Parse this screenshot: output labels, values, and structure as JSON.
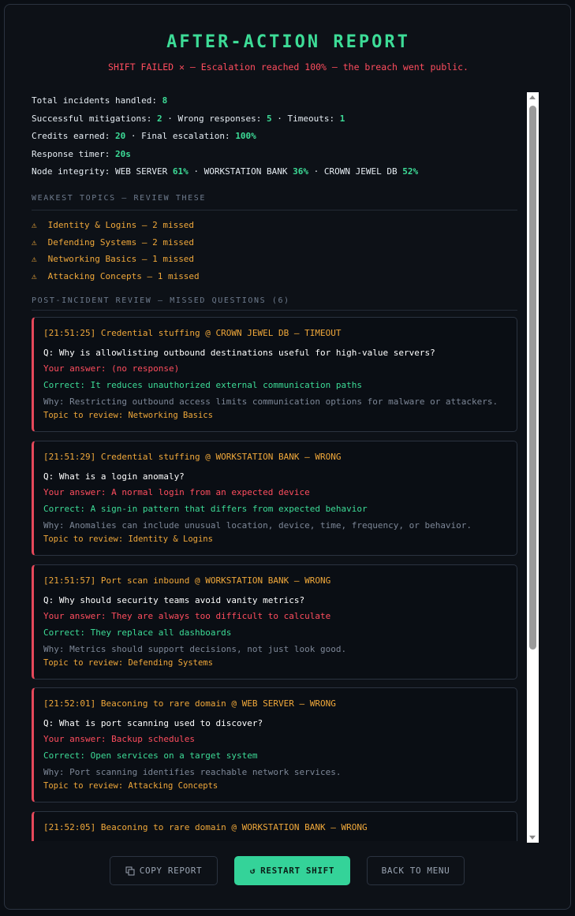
{
  "header": {
    "title": "AFTER-ACTION REPORT",
    "subtitle": "SHIFT FAILED ✕ — Escalation reached 100% — the breach went public."
  },
  "stats": {
    "total_label": "Total incidents handled:",
    "total_value": "8",
    "success_label": "Successful mitigations:",
    "success_value": "2",
    "wrong_label": "Wrong responses:",
    "wrong_value": "5",
    "timeouts_label": "Timeouts:",
    "timeouts_value": "1",
    "credits_label": "Credits earned:",
    "credits_value": "20",
    "escalation_label": "Final escalation:",
    "escalation_value": "100%",
    "timer_label": "Response timer:",
    "timer_value": "20s",
    "integrity_label": "Node integrity:",
    "nodes": [
      {
        "name": "WEB SERVER",
        "value": "61%"
      },
      {
        "name": "WORKSTATION BANK",
        "value": "36%"
      },
      {
        "name": "CROWN JEWEL DB",
        "value": "52%"
      }
    ],
    "separator": "·"
  },
  "weakest": {
    "heading": "WEAKEST TOPICS — REVIEW THESE",
    "icon": "warning-icon",
    "items": [
      "Identity & Logins — 2 missed",
      "Defending Systems — 2 missed",
      "Networking Basics — 1 missed",
      "Attacking Concepts — 1 missed"
    ]
  },
  "review": {
    "heading": "POST-INCIDENT REVIEW — MISSED QUESTIONS (6)",
    "cards": [
      {
        "head": "[21:51:25] Credential stuffing @ CROWN JEWEL DB — TIMEOUT",
        "question": "Q: Why is allowlisting outbound destinations useful for high-value servers?",
        "your_answer": "Your answer: (no response)",
        "correct": "Correct: It reduces unauthorized external communication paths",
        "why": "Why: Restricting outbound access limits communication options for malware or attackers.",
        "topic": "Topic to review: Networking Basics"
      },
      {
        "head": "[21:51:29] Credential stuffing @ WORKSTATION BANK — WRONG",
        "question": "Q: What is a login anomaly?",
        "your_answer": "Your answer: A normal login from an expected device",
        "correct": "Correct: A sign-in pattern that differs from expected behavior",
        "why": "Why: Anomalies can include unusual location, device, time, frequency, or behavior.",
        "topic": "Topic to review: Identity & Logins"
      },
      {
        "head": "[21:51:57] Port scan inbound @ WORKSTATION BANK — WRONG",
        "question": "Q: Why should security teams avoid vanity metrics?",
        "your_answer": "Your answer: They are always too difficult to calculate",
        "correct": "Correct: They replace all dashboards",
        "why": "Why: Metrics should support decisions, not just look good.",
        "topic": "Topic to review: Defending Systems"
      },
      {
        "head": "[21:52:01] Beaconing to rare domain @ WEB SERVER — WRONG",
        "question": "Q: What is port scanning used to discover?",
        "your_answer": "Your answer: Backup schedules",
        "correct": "Correct: Open services on a target system",
        "why": "Why: Port scanning identifies reachable network services.",
        "topic": "Topic to review: Attacking Concepts"
      },
      {
        "head": "[21:52:05] Beaconing to rare domain @ WORKSTATION BANK — WRONG",
        "question": "",
        "your_answer": "",
        "correct": "",
        "why": "",
        "topic": ""
      }
    ]
  },
  "buttons": {
    "copy": "COPY REPORT",
    "copy_icon": "copy-icon",
    "restart": "RESTART SHIFT",
    "restart_icon": "restart-icon",
    "menu": "BACK TO MENU"
  }
}
